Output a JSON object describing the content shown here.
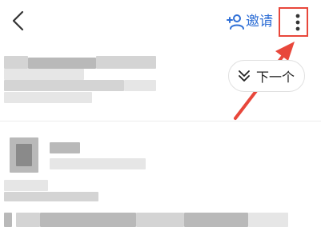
{
  "header": {
    "back_icon": "chevron-left-icon",
    "invite_icon": "person-add-icon",
    "invite_label": "邀请",
    "more_icon": "more-vertical-icon"
  },
  "next_button": {
    "icon": "double-chevron-down-icon",
    "label": "下一个"
  },
  "annotation": {
    "color": "#e8473b"
  },
  "accent_color": "#2f6fd6"
}
